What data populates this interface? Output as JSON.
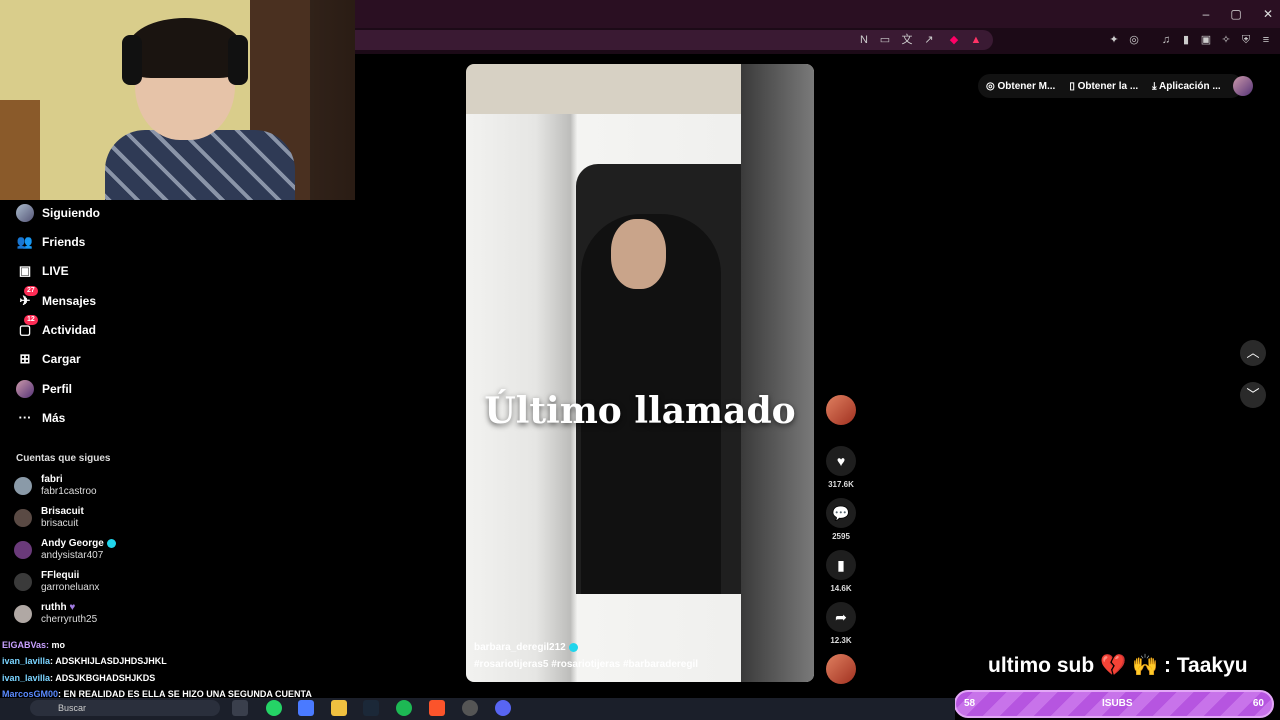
{
  "sidebar": {
    "nav": [
      {
        "label": "Siguiendo",
        "icon": "avatar-icon"
      },
      {
        "label": "Friends",
        "icon": "friends-icon"
      },
      {
        "label": "LIVE",
        "icon": "live-icon"
      },
      {
        "label": "Mensajes",
        "icon": "messages-icon",
        "badge": "27"
      },
      {
        "label": "Actividad",
        "icon": "activity-icon",
        "badge": "12"
      },
      {
        "label": "Cargar",
        "icon": "upload-icon"
      },
      {
        "label": "Perfil",
        "icon": "profile-icon"
      },
      {
        "label": "Más",
        "icon": "more-icon"
      }
    ],
    "following_title": "Cuentas que sigues",
    "accounts": [
      {
        "name": "fabri",
        "handle": "fabr1castroo",
        "verified": false
      },
      {
        "name": "Brisacuit",
        "handle": "brisacuit",
        "verified": false
      },
      {
        "name": "Andy George",
        "handle": "andysistar407",
        "verified": true
      },
      {
        "name": "FFlequii",
        "handle": "garroneluanx",
        "verified": false
      },
      {
        "name": "ruthh",
        "handle": "cherryruth25",
        "verified": false
      }
    ]
  },
  "chat": [
    {
      "user": "ElGABVas:",
      "text": "mo"
    },
    {
      "user": "ivan_lavilla",
      "text": ": ADSKHIJLASDJHDSJHKL"
    },
    {
      "user": "ivan_lavilla",
      "text": ": ADSJKBGHADSHJKDS"
    },
    {
      "user": "MarcosGM00",
      "text": ": EN REALIDAD ES ELLA SE HIZO UNA SEGUNDA CUENTA"
    }
  ],
  "video": {
    "overlay_title": "Último llamado",
    "author": "barbara_deregil212",
    "tags": "#rosariotijeras5  #rosariotijeras  #barbaraderegil"
  },
  "actions": {
    "likes": "317.6K",
    "comments": "2595",
    "saves": "14.6K",
    "shares": "12.3K"
  },
  "topbar": {
    "pills": [
      "Obtener M...",
      "Obtener la ...",
      "Aplicación ..."
    ]
  },
  "overlay": {
    "sub_message": "ultimo sub 💔 🙌 : Taakyu",
    "goal_left": "58",
    "goal_mid": "ISUBS",
    "goal_right": "60"
  },
  "taskbar": {
    "search_placeholder": "Buscar"
  },
  "colors": {
    "accent": "#fe2c55",
    "verified": "#20d5ec",
    "goal_bar": "#c873ea"
  }
}
